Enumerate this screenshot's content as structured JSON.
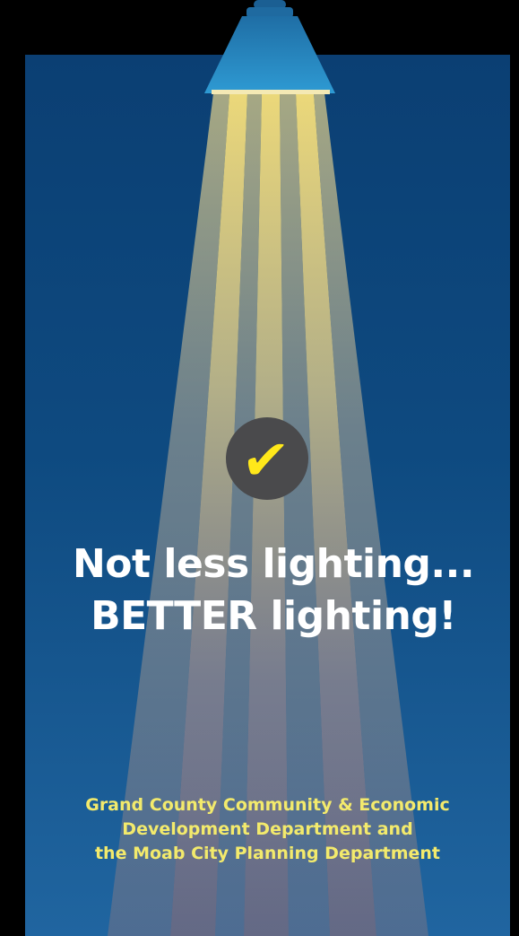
{
  "colors": {
    "background": "#000000",
    "panel_top": "#0b3f73",
    "panel_bottom": "#2065a0",
    "lamp_shade": "#2a8fc7",
    "beam_light": "#f0da78",
    "check_badge": "#4a4a4c",
    "check_mark": "#ffe81a",
    "headline": "#ffffff",
    "credits": "#f3ea6c"
  },
  "icons": {
    "lamp": "street-lamp-icon",
    "check": "checkmark-icon"
  },
  "check_glyph": "✔",
  "headline": {
    "line1": "Not less lighting...",
    "line2": "BETTER lighting!"
  },
  "credits": {
    "line1": "Grand County Community & Economic",
    "line2": "Development Department and",
    "line3": "the Moab City Planning Department"
  }
}
